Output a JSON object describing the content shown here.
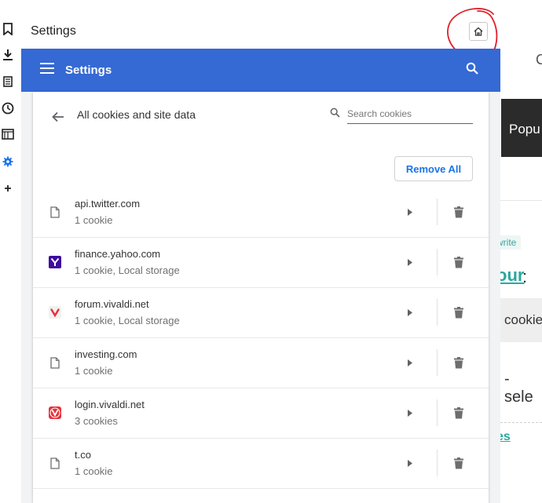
{
  "window": {
    "title": "Settings"
  },
  "appbar": {
    "title": "Settings"
  },
  "cookies": {
    "heading": "All cookies and site data",
    "search_placeholder": "Search cookies",
    "remove_all_label": "Remove All",
    "sites": [
      {
        "name": "api.twitter.com",
        "detail": "1 cookie",
        "icon": "generic-page-icon"
      },
      {
        "name": "finance.yahoo.com",
        "detail": "1 cookie, Local storage",
        "icon": "yahoo-favicon"
      },
      {
        "name": "forum.vivaldi.net",
        "detail": "1 cookie, Local storage",
        "icon": "vivaldi-favicon"
      },
      {
        "name": "investing.com",
        "detail": "1 cookie",
        "icon": "generic-page-icon"
      },
      {
        "name": "login.vivaldi.net",
        "detail": "3 cookies",
        "icon": "vivaldi-favicon"
      },
      {
        "name": "t.co",
        "detail": "1 cookie",
        "icon": "generic-page-icon"
      }
    ]
  },
  "background_page": {
    "c_text": "C",
    "dark_box_text": "Popu",
    "tag_text": "write",
    "link_text": "our",
    "colon": ":",
    "grey_box_text": "cookie",
    "sele_text": "- sele",
    "bottom_link_text": "es"
  },
  "colors": {
    "accent": "#3569d4",
    "link": "#1a73e8",
    "annotation": "#e0202a"
  }
}
